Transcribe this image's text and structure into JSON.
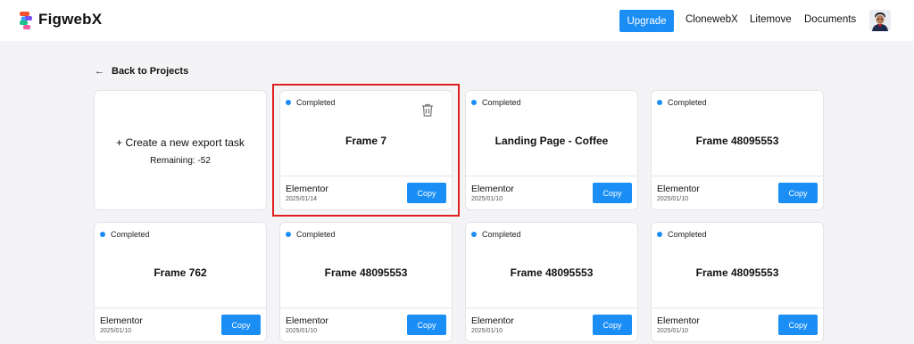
{
  "header": {
    "brand": "FigwebX",
    "upgrade_label": "Upgrade",
    "nav": [
      "ClonewebX",
      "Litemove",
      "Documents"
    ],
    "colors": {
      "accent": "#1a8ef5",
      "highlight": "#e02020"
    }
  },
  "back_label": "Back to Projects",
  "new_task": {
    "title": "+ Create a new export task",
    "remaining": "Remaining: -52"
  },
  "copy_label": "Copy",
  "cards": [
    {
      "status": "Completed",
      "title": "Frame 7",
      "platform": "Elementor",
      "date": "2025/01/14",
      "has_delete": true,
      "selected": true
    },
    {
      "status": "Completed",
      "title": "Landing Page - Coffee",
      "platform": "Elementor",
      "date": "2025/01/10",
      "has_delete": false
    },
    {
      "status": "Completed",
      "title": "Frame 48095553",
      "platform": "Elementor",
      "date": "2025/01/10",
      "has_delete": false
    },
    {
      "status": "Completed",
      "title": "Frame 762",
      "platform": "Elementor",
      "date": "2025/01/10",
      "has_delete": false
    },
    {
      "status": "Completed",
      "title": "Frame 48095553",
      "platform": "Elementor",
      "date": "2025/01/10",
      "has_delete": false
    },
    {
      "status": "Completed",
      "title": "Frame 48095553",
      "platform": "Elementor",
      "date": "2025/01/10",
      "has_delete": false
    },
    {
      "status": "Completed",
      "title": "Frame 48095553",
      "platform": "Elementor",
      "date": "2025/01/10",
      "has_delete": false
    }
  ]
}
